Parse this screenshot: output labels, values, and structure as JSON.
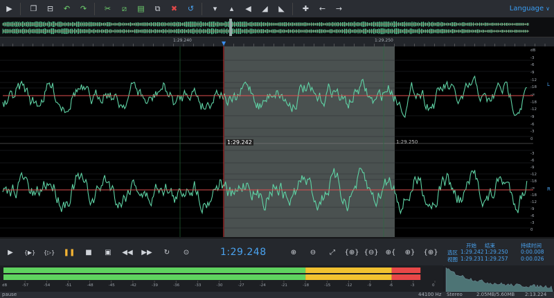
{
  "toolbar": {
    "icons": [
      "play-icon",
      "open-folder-icon",
      "export-icon",
      "undo-icon",
      "redo-icon",
      "cut-icon",
      "crop-icon",
      "paste-icon",
      "copy-icon",
      "delete-icon",
      "reload-icon",
      "dropdown-icon",
      "up-icon",
      "volume-icon",
      "fade-in-icon",
      "fade-out-icon",
      "add-marker-icon",
      "arrow-left-icon",
      "arrow-right-icon"
    ],
    "language_label": "Language"
  },
  "ruler": {
    "labels": [
      "1:29.240",
      "1:29.250"
    ]
  },
  "waveform": {
    "cursor_label": "1:29.242",
    "selection_end_label": "1:29.250",
    "db_scale_top": [
      "dB",
      "-3",
      "-6",
      "-9",
      "-12",
      "-18",
      "-∞",
      "-18",
      "-12",
      "-9",
      "-6",
      "-3",
      "0"
    ],
    "db_scale_bottom": [
      "-3",
      "-6",
      "-9",
      "-12",
      "-18",
      "-∞",
      "-18",
      "-12",
      "-9",
      "-6",
      "-3",
      "0"
    ],
    "channel_top": "L",
    "channel_bottom": "R",
    "colors": {
      "wave": "#5fd3a5",
      "center_line": "#e05050",
      "selection": "#4a5150",
      "cursor": "#e04040"
    }
  },
  "transport": {
    "time": "1:29.248",
    "labels": {
      "start": "开始",
      "end": "结束",
      "duration": "持续时间",
      "selection": "选区",
      "view": "视图"
    },
    "selection": {
      "start": "1:29.242",
      "end": "1:29.250",
      "duration": "0:00.008"
    },
    "view": {
      "start": "1:29.231",
      "end": "1:29.257",
      "duration": "0:00.026"
    }
  },
  "meter": {
    "ticks": [
      "dB",
      "-57",
      "-54",
      "-51",
      "-48",
      "-45",
      "-42",
      "-39",
      "-36",
      "-33",
      "-30",
      "-27",
      "-24",
      "-21",
      "-18",
      "-15",
      "-12",
      "-9",
      "-6",
      "-3",
      "0"
    ],
    "level_db": -2
  },
  "status": {
    "state": "pause",
    "sample_rate": "44100 Hz",
    "channels": "Stereo",
    "size": "2.05MB/5.60MB",
    "duration": "2:13.224"
  }
}
